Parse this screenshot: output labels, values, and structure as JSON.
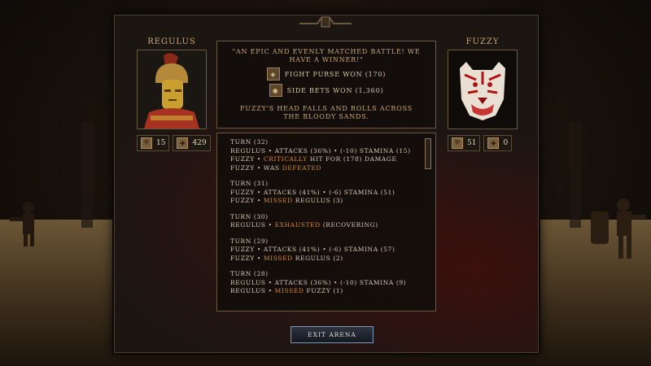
{
  "left_fighter": {
    "name": "Regulus",
    "stat1": "15",
    "stat2": "429"
  },
  "right_fighter": {
    "name": "Fuzzy",
    "stat1": "51",
    "stat2": "0"
  },
  "result": {
    "quote": "\"An epic and evenly matched battle! We have a winner!\"",
    "purse_label": "Fight purse won (170)",
    "bets_label": "Side bets won (1,360)",
    "outcome": "Fuzzy's head falls and rolls across the bloody sands."
  },
  "log": [
    {
      "turn": "Turn (32)",
      "lines": [
        {
          "parts": [
            {
              "t": "Regulus • Attacks (36%) • (-10) Stamina (15)"
            }
          ]
        },
        {
          "parts": [
            {
              "t": "Fuzzy • "
            },
            {
              "t": "Critically",
              "h": true
            },
            {
              "t": " hit for (178) damage"
            }
          ]
        },
        {
          "parts": [
            {
              "t": "Fuzzy • Was "
            },
            {
              "t": "defeated",
              "h": true
            }
          ]
        }
      ]
    },
    {
      "turn": "Turn (31)",
      "lines": [
        {
          "parts": [
            {
              "t": "Fuzzy • Attacks (41%) • (-6) Stamina (51)"
            }
          ]
        },
        {
          "parts": [
            {
              "t": "Fuzzy • "
            },
            {
              "t": "Missed",
              "h": true
            },
            {
              "t": " Regulus (3)"
            }
          ]
        }
      ]
    },
    {
      "turn": "Turn (30)",
      "lines": [
        {
          "parts": [
            {
              "t": "Regulus • "
            },
            {
              "t": "Exhausted",
              "h": true
            },
            {
              "t": " (recovering)"
            }
          ]
        }
      ]
    },
    {
      "turn": "Turn (29)",
      "lines": [
        {
          "parts": [
            {
              "t": "Fuzzy • Attacks (41%) • (-6) Stamina (57)"
            }
          ]
        },
        {
          "parts": [
            {
              "t": "Fuzzy • "
            },
            {
              "t": "Missed",
              "h": true
            },
            {
              "t": " Regulus (2)"
            }
          ]
        }
      ]
    },
    {
      "turn": "Turn (28)",
      "lines": [
        {
          "parts": [
            {
              "t": "Regulus • Attacks (36%) • (-10) Stamina (9)"
            }
          ]
        },
        {
          "parts": [
            {
              "t": "Regulus • "
            },
            {
              "t": "Missed",
              "h": true
            },
            {
              "t": " Fuzzy (1)"
            }
          ]
        }
      ]
    }
  ],
  "exit_button": "Exit Arena",
  "colors": {
    "highlight": "#d48a36",
    "text": "#d6c9b4",
    "gold": "#c9a878"
  }
}
